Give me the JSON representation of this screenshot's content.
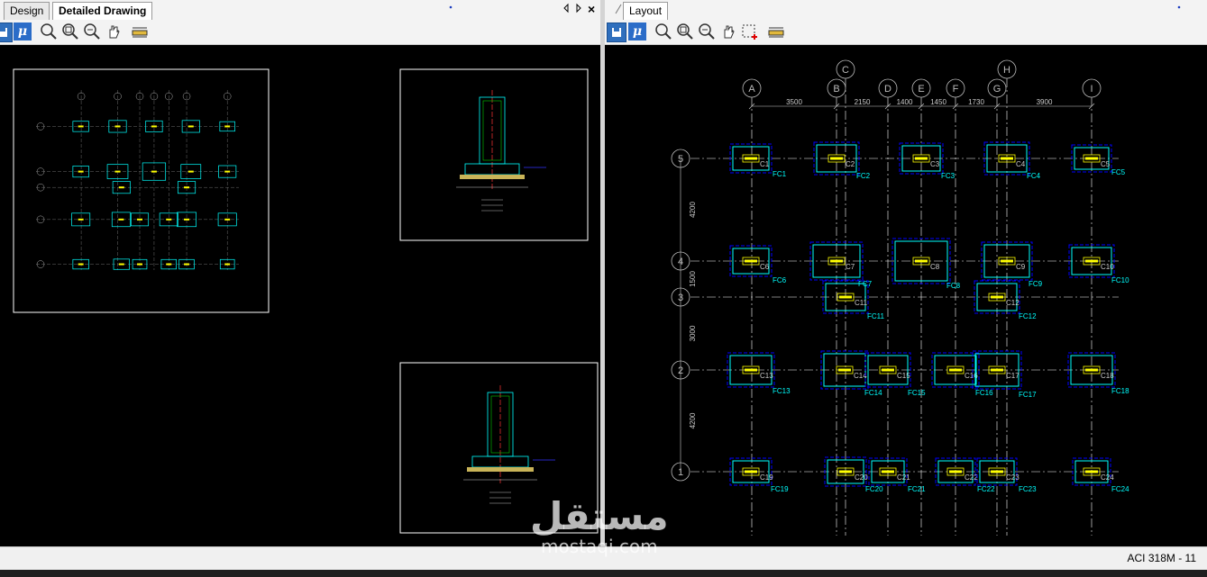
{
  "left_pane": {
    "tabs": [
      {
        "label": "Design",
        "active": false
      },
      {
        "label": "Detailed Drawing",
        "active": true
      }
    ],
    "controls": [
      "pin-icon",
      "scroll-left-icon",
      "scroll-right-icon",
      "close-icon"
    ],
    "close_glyph": "×"
  },
  "right_pane": {
    "tabs": [
      {
        "label": "Layout",
        "active": true
      }
    ]
  },
  "toolbar_icons": [
    "save-icon",
    "mu-icon",
    "zoom-icon",
    "zoom-window-icon",
    "zoom-extents-icon",
    "pan-icon",
    "measure-icon"
  ],
  "toolbar_right_extra": "select-window-icon",
  "mu_glyph": "μ",
  "colors": {
    "canvas": "#000000",
    "column": "#ffff00",
    "footing": "#00ffff",
    "footing_outline": "#0000ff",
    "grid": "#ffffff",
    "label": "#00ffff"
  },
  "layout": {
    "grid_x_labels": [
      "A",
      "B",
      "C",
      "D",
      "E",
      "F",
      "G",
      "H",
      "I"
    ],
    "grid_y_labels": [
      "5",
      "4",
      "3",
      "2",
      "1"
    ],
    "x_dimensions": [
      "3500",
      "2150",
      "1400",
      "1450",
      "1730",
      "3900"
    ],
    "y_dimensions": [
      "4200",
      "1500",
      "3000",
      "4200"
    ],
    "columns": [
      "C1",
      "C2",
      "C3",
      "C4",
      "C5",
      "C6",
      "C7",
      "C8",
      "C9",
      "C10",
      "C11",
      "C12",
      "C13",
      "C14",
      "C15",
      "C16",
      "C17",
      "C18",
      "C19",
      "C20",
      "C21",
      "C22",
      "C23",
      "C24"
    ],
    "footings": [
      "FC1",
      "FC2",
      "FC3",
      "FC4",
      "FC5",
      "FC6",
      "FC7",
      "FC8",
      "FC9",
      "FC10",
      "FC11",
      "FC12",
      "FC13",
      "FC14",
      "FC15",
      "FC16",
      "FC17",
      "FC18",
      "FC19",
      "FC20",
      "FC21",
      "FC22",
      "FC23",
      "FC24"
    ]
  },
  "status": {
    "code": "ACI 318M - 11"
  },
  "watermark": {
    "arabic": "مستقل",
    "latin": "mostaqi.com"
  }
}
